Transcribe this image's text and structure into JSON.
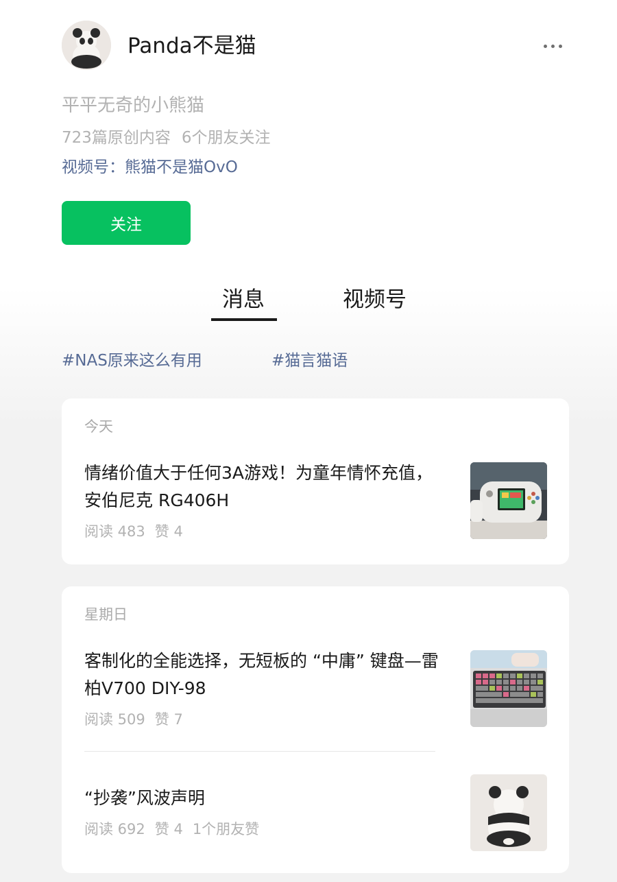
{
  "profile": {
    "name": "Panda不是猫",
    "bio": "平平无奇的小熊猫",
    "original_count": "723篇原创内容",
    "friends_following": "6个朋友关注",
    "channel": "视频号：熊猫不是猫OvO",
    "follow_label": "关注",
    "more_icon": "more-dots-icon"
  },
  "tabs": [
    {
      "label": "消息",
      "active": true
    },
    {
      "label": "视频号",
      "active": false
    }
  ],
  "tags": [
    "#NAS原来这么有用",
    "#猫言猫语"
  ],
  "groups": [
    {
      "date": "今天",
      "articles": [
        {
          "title": "情绪价值大于任何3A游戏！为童年情怀充值，安伯尼克 RG406H",
          "reads": "阅读 483",
          "likes": "赞 4",
          "thumb": "handheld-console-thumbnail"
        }
      ]
    },
    {
      "date": "星期日",
      "articles": [
        {
          "title": "客制化的全能选择，无短板的 “中庸” 键盘—雷柏V700 DIY-98",
          "reads": "阅读 509",
          "likes": "赞 7",
          "thumb": "keyboard-thumbnail"
        },
        {
          "title": "“抄袭”风波声明",
          "reads": "阅读 692",
          "likes": "赞 4",
          "friend_likes": "1个朋友赞",
          "thumb": "panda-thumbnail"
        }
      ]
    }
  ],
  "colors": {
    "accent": "#07c160",
    "link": "#576b95",
    "muted": "#b2b2b2",
    "text": "#1a1a1a"
  }
}
